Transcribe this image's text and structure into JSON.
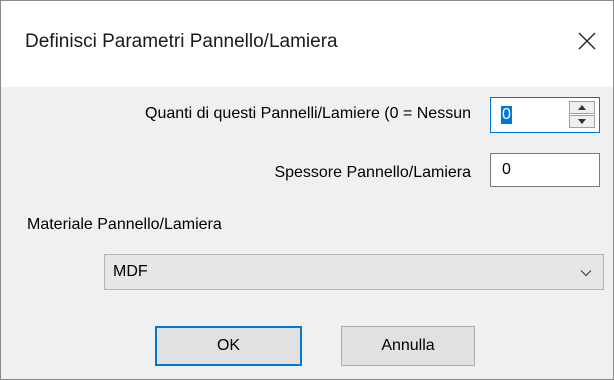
{
  "window": {
    "title": "Definisci Parametri Pannello/Lamiera",
    "close_icon": "close-icon"
  },
  "fields": {
    "quantity": {
      "label": "Quanti di questi Pannelli/Lamiere (0 = Nessun",
      "value": "0"
    },
    "thickness": {
      "label": "Spessore Pannello/Lamiera",
      "value": "0"
    },
    "material": {
      "label": "Materiale Pannello/Lamiera",
      "selected": "MDF"
    }
  },
  "buttons": {
    "ok_label": "OK",
    "cancel_label": "Annulla"
  },
  "colors": {
    "accent": "#0078d7",
    "dialog_bg": "#f0f0f0",
    "title_bg": "#ffffff"
  }
}
